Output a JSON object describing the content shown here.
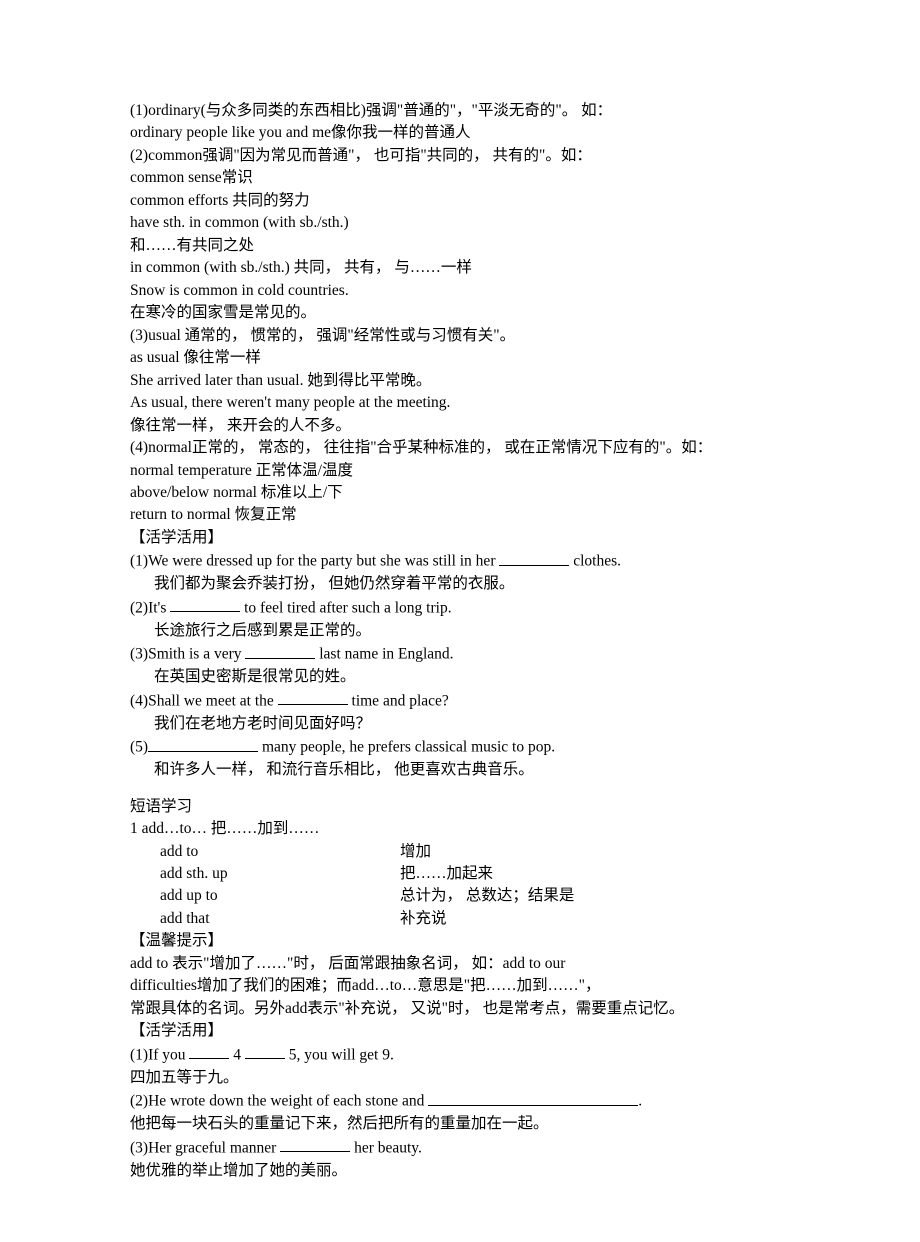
{
  "p1": "(1)ordinary(与众多同类的东西相比)强调\"普通的\"，\"平淡无奇的\"。 如：",
  "p2": "ordinary people like you and me像你我一样的普通人",
  "p3": "(2)common强调\"因为常见而普通\"， 也可指\"共同的， 共有的\"。如：",
  "p4": "common sense常识",
  "p5": "common efforts  共同的努力",
  "p6": "have sth. in common (with sb./sth.)",
  "p7": "和……有共同之处",
  "p8": "in common (with sb./sth.)  共同， 共有， 与……一样",
  "p9": "Snow is common in cold countries.",
  "p10": "在寒冷的国家雪是常见的。",
  "p11": "(3)usual 通常的， 惯常的， 强调\"经常性或与习惯有关\"。",
  "p12": "as usual 像往常一样",
  "p13": "She arrived later than usual. 她到得比平常晚。",
  "p14": "As usual, there weren't many people at the meeting.",
  "p15": "像往常一样， 来开会的人不多。",
  "p16": "(4)normal正常的， 常态的， 往往指\"合乎某种标准的， 或在正常情况下应有的\"。如：",
  "p17": "normal temperature 正常体温/温度",
  "p18": "above/below normal  标准以上/下",
  "p19": "return to normal  恢复正常",
  "p20": "【活学活用】",
  "p21a": "(1)We were dressed up for the party but she was still in her ",
  "p21b": " clothes.",
  "p22": "我们都为聚会乔装打扮， 但她仍然穿着平常的衣服。",
  "p23a": "(2)It's ",
  "p23b": " to feel tired after such a long trip.",
  "p24": "长途旅行之后感到累是正常的。",
  "p25a": "(3)Smith is a very ",
  "p25b": " last name in England.",
  "p26": "在英国史密斯是很常见的姓。",
  "p27a": "(4)Shall we meet at the ",
  "p27b": " time and place?",
  "p28": "我们在老地方老时间见面好吗？",
  "p29a": "(5)",
  "p29b": " many people, he prefers classical music to pop.",
  "p30": "和许多人一样， 和流行音乐相比， 他更喜欢古典音乐。",
  "p31": "短语学习",
  "add1a": "1    add…to…   把……加到……",
  "add2a": "add to",
  "add2b": "增加",
  "add3a": "add sth. up",
  "add3b": "把……加起来",
  "add4a": "add up to",
  "add4b": "总计为， 总数达；结果是",
  "add5a": "add that",
  "add5b": "补充说",
  "p32": "【温馨提示】",
  "p33": "add to 表示\"增加了……\"时， 后面常跟抽象名词， 如：add to our",
  "p34": "difficulties增加了我们的困难；而add…to…意思是\"把……加到……\"，",
  "p35": "常跟具体的名词。另外add表示\"补充说， 又说\"时， 也是常考点，需要重点记忆。",
  "p36": "【活学活用】",
  "p37a": "(1)If you ",
  "p37b": " 4 ",
  "p37c": " 5, you will get 9.",
  "p38": "四加五等于九。",
  "p39a": "(2)He wrote down the weight of each stone and ",
  "p39b": ".",
  "p40": "他把每一块石头的重量记下来，然后把所有的重量加在一起。",
  "p41a": "(3)Her graceful manner ",
  "p41b": " her beauty.",
  "p42": "她优雅的举止增加了她的美丽。"
}
